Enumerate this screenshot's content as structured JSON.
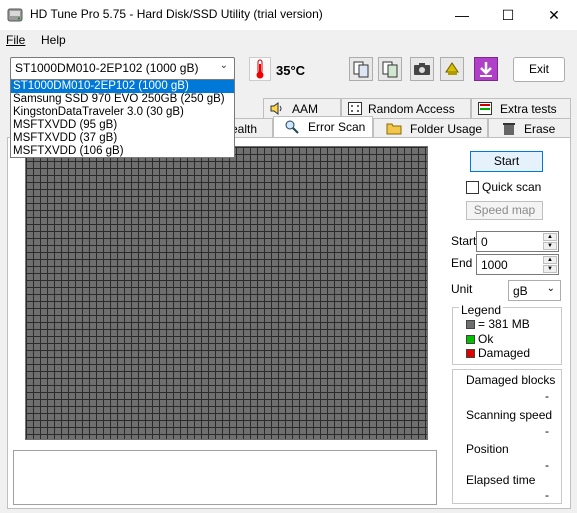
{
  "window": {
    "title": "HD Tune Pro 5.75 - Hard Disk/SSD Utility (trial version)",
    "minimize": "—",
    "maximize": "☐",
    "close": "✕"
  },
  "menu": {
    "file": "File",
    "help": "Help"
  },
  "toolbar": {
    "selected_drive": "ST1000DM010-2EP102 (1000 gB)",
    "temperature": "35°C",
    "exit_label": "Exit",
    "icons": [
      "copy-info-icon",
      "copy-screen-icon",
      "screenshot-camera-icon",
      "options-icon",
      "save-download-icon"
    ]
  },
  "drives": [
    "ST1000DM010-2EP102 (1000 gB)",
    "Samsung SSD 970 EVO 250GB (250 gB)",
    "KingstonDataTraveler 3.0 (30 gB)",
    "MSFTXVDD (95 gB)",
    "MSFTXVDD (37 gB)",
    "MSFTXVDD (106 gB)"
  ],
  "tabs_row1": [
    {
      "label": "AAM",
      "icon": "speaker-icon"
    },
    {
      "label": "Random Access",
      "icon": "dice-icon"
    },
    {
      "label": "Extra tests",
      "icon": "extra-tests-icon"
    }
  ],
  "tabs_row2": [
    {
      "label": "ealth",
      "icon": "health-icon"
    },
    {
      "label": "Error Scan",
      "icon": "magnifier-icon"
    },
    {
      "label": "Folder Usage",
      "icon": "folder-icon"
    },
    {
      "label": "Erase",
      "icon": "trash-icon"
    }
  ],
  "scan": {
    "start_label": "Start",
    "quick_scan_label": "Quick scan",
    "speed_map_label": "Speed map",
    "start_field_label": "Start",
    "start_value": "0",
    "end_field_label": "End",
    "end_value": "1000",
    "unit_label": "Unit",
    "unit_value": "gB"
  },
  "legend": {
    "title": "Legend",
    "block_size": "= 381 MB",
    "ok": "Ok",
    "damaged": "Damaged",
    "colors": {
      "block": "#6f6f6f",
      "ok": "#00c000",
      "damaged": "#e00000"
    }
  },
  "stats": [
    {
      "label": "Damaged blocks",
      "value": "-"
    },
    {
      "label": "Scanning speed",
      "value": "-"
    },
    {
      "label": "Position",
      "value": "-"
    },
    {
      "label": "Elapsed time",
      "value": "-"
    }
  ]
}
